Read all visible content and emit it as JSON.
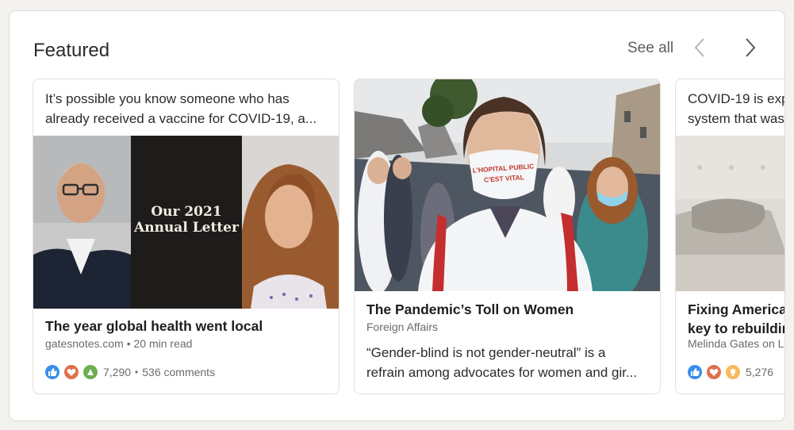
{
  "section": {
    "title": "Featured",
    "see_all_label": "See all",
    "prev_icon": "chevron-left-icon",
    "next_icon": "chevron-right-icon"
  },
  "cards": [
    {
      "intro_line_1": "It’s possible you know someone who has",
      "intro_line_2": "already received a vaccine for COVID-19, a...",
      "image_text_line_1": "Our 2021",
      "image_text_line_2": "Annual Letter",
      "title": "The year global health went local",
      "subtitle": "gatesnotes.com • 20 min read",
      "reaction_icons": [
        "like-icon",
        "love-icon",
        "support-icon"
      ],
      "reaction_count": "7,290",
      "comments": "536 comments"
    },
    {
      "image_mask_line_1": "L'HOPITAL PUBLIC",
      "image_mask_line_2": "C'EST VITAL",
      "title": "The Pandemic’s Toll on Women",
      "subtitle": "Foreign Affairs",
      "desc_line_1": "“Gender-blind is not gender-neutral” is a",
      "desc_line_2": "refrain among advocates for women and gir..."
    },
    {
      "intro_line_1": "COVID-19 is exp",
      "intro_line_2": "system that was",
      "title_line_1": "Fixing America’s",
      "title_line_2": "key to rebuildin",
      "subtitle": "Melinda Gates on L",
      "reaction_icons": [
        "like-icon",
        "love-icon",
        "insightful-icon"
      ],
      "reaction_count": "5,276"
    }
  ],
  "colors": {
    "like": "#378fe9",
    "love": "#df704d",
    "support": "#6dae4f",
    "insightful": "#f5bb5c"
  }
}
